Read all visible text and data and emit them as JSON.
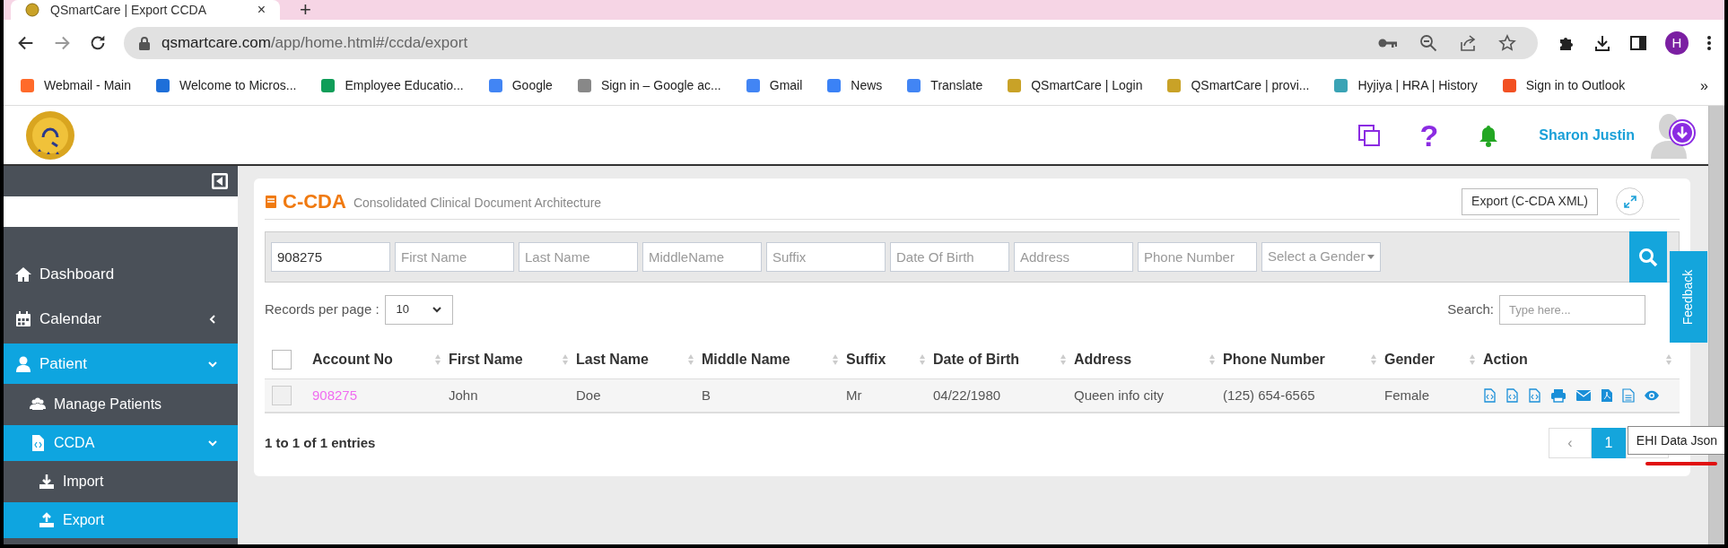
{
  "browser": {
    "tab": {
      "title": "QSmartCare | Export CCDA",
      "close": "×"
    },
    "new_tab": "+",
    "url": {
      "host": "qsmartcare.com",
      "path": "/app/home.html#/ccda/export"
    },
    "profile_initial": "H",
    "bookmarks": [
      {
        "label": "Webmail - Main"
      },
      {
        "label": "Welcome to Micros..."
      },
      {
        "label": "Employee Educatio..."
      },
      {
        "label": "Google"
      },
      {
        "label": "Sign in – Google ac..."
      },
      {
        "label": "Gmail"
      },
      {
        "label": "News"
      },
      {
        "label": "Translate"
      },
      {
        "label": "QSmartCare | Login"
      },
      {
        "label": "QSmartCare | provi..."
      },
      {
        "label": "Hyjiya | HRA | History"
      },
      {
        "label": "Sign in to Outlook"
      }
    ],
    "more_bookmarks": "»"
  },
  "header": {
    "help": "?",
    "user_name": "Sharon Justin"
  },
  "sidebar": {
    "items": [
      {
        "label": "Dashboard",
        "selected": false
      },
      {
        "label": "Calendar",
        "selected": false,
        "expanded": false
      },
      {
        "label": "Patient",
        "selected": true,
        "expanded": true,
        "children": [
          {
            "label": "Manage Patients",
            "selected": false
          },
          {
            "label": "CCDA",
            "selected": true,
            "expanded": true,
            "children": [
              {
                "label": "Import",
                "selected": false
              },
              {
                "label": "Export",
                "selected": true
              }
            ]
          }
        ]
      }
    ]
  },
  "page": {
    "title": "C-CDA",
    "subtitle": "Consolidated Clinical Document Architecture",
    "export_button": "Export (C-CDA XML)",
    "filters": [
      {
        "value": "908275"
      },
      {
        "placeholder": "First Name"
      },
      {
        "placeholder": "Last Name"
      },
      {
        "placeholder": "MiddleName"
      },
      {
        "placeholder": "Suffix"
      },
      {
        "placeholder": "Date Of Birth"
      },
      {
        "placeholder": "Address"
      },
      {
        "placeholder": "Phone Number"
      }
    ],
    "gender_select": {
      "placeholder": "Select a Gender"
    },
    "records_label": "Records per page :",
    "page_size": "10",
    "search_label": "Search:",
    "search_placeholder": "Type here...",
    "table": {
      "select_all_checked": false,
      "columns": [
        "Account No",
        "First Name",
        "Last Name",
        "Middle Name",
        "Suffix",
        "Date of Birth",
        "Address",
        "Phone Number",
        "Gender",
        "Action"
      ],
      "rows": [
        {
          "checked": false,
          "cells": [
            "908275",
            "John",
            "Doe",
            "B",
            "Mr",
            "04/22/1980",
            "Queen info city",
            "(125) 654-6565",
            "Female"
          ]
        }
      ]
    },
    "summary": "1 to 1 of 1 entries",
    "pagination": {
      "prev": "‹",
      "pages": [
        {
          "label": "1",
          "selected": true
        }
      ]
    }
  },
  "feedback": "Feedback",
  "tooltip": "EHI Data Json"
}
